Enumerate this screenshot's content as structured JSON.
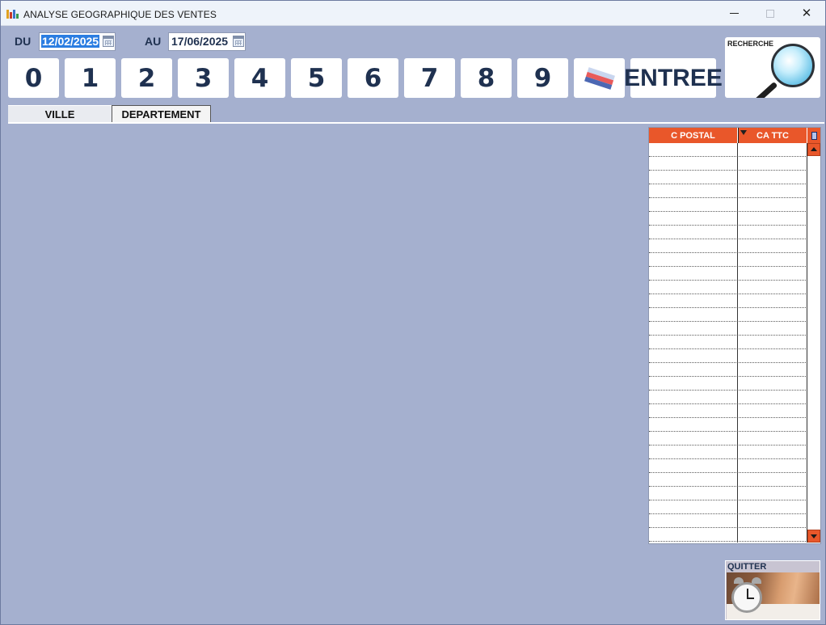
{
  "window": {
    "title": "ANALYSE GEOGRAPHIQUE DES VENTES",
    "controls": {
      "minimize": "minimize-icon",
      "maximize": "maximize-icon",
      "close": "close-icon"
    }
  },
  "dates": {
    "from_label": "DU",
    "from_value": "12/02/2025",
    "to_label": "AU",
    "to_value": "17/06/2025"
  },
  "keypad": {
    "keys": [
      "0",
      "1",
      "2",
      "3",
      "4",
      "5",
      "6",
      "7",
      "8",
      "9"
    ],
    "eraser_icon": "eraser-icon",
    "enter_label": "ENTREE"
  },
  "search": {
    "label": "RECHERCHE",
    "icon": "magnifier-icon"
  },
  "tabs": [
    {
      "label": "VILLE",
      "active": true
    },
    {
      "label": "DEPARTEMENT",
      "active": false
    }
  ],
  "grid": {
    "columns": [
      "C POSTAL",
      "CA TTC"
    ],
    "corner_icon": "table-options-icon",
    "header_color": "#e9572a",
    "rows": []
  },
  "quit": {
    "label": "QUITTER",
    "icon": "alarm-clock-icon"
  },
  "colors": {
    "background": "#a5b0cf",
    "text": "#1f3150",
    "accent": "#e9572a",
    "selection": "#2b7de1"
  }
}
